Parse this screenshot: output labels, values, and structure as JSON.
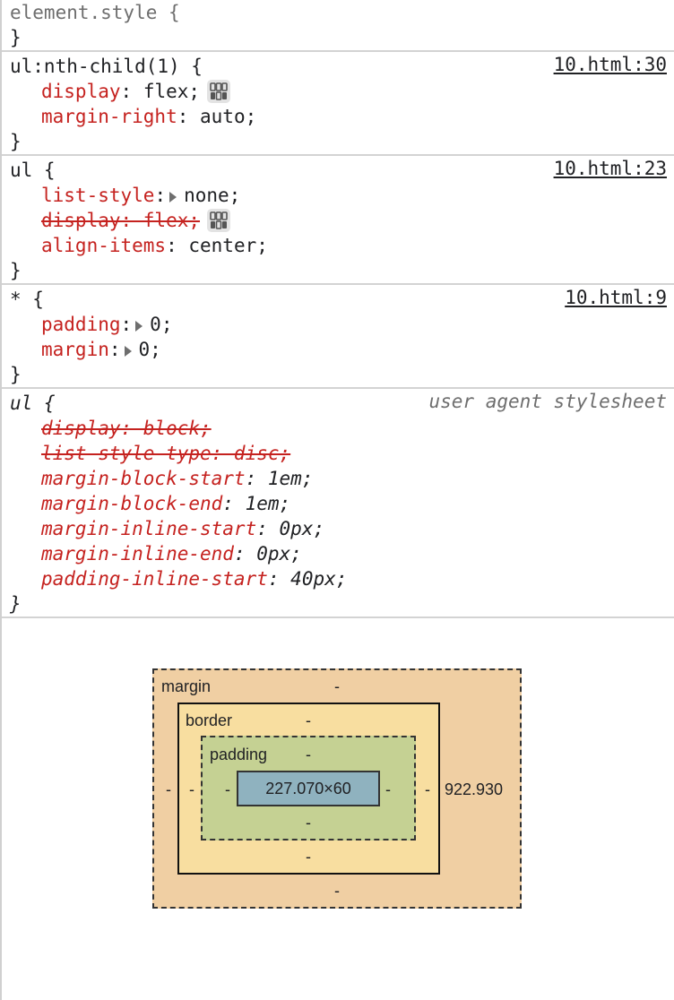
{
  "colors": {
    "property": "#c5221f",
    "margin_box": "#f0cfa3",
    "border_box": "#f8dea0",
    "padding_box": "#c5d193",
    "content_box": "#8fb2bf"
  },
  "element_style": {
    "selector": "element.style {",
    "close": "}"
  },
  "rules": [
    {
      "selector": "ul:nth-child(1) {",
      "source": "10.html:30",
      "decls": [
        {
          "prop": "display",
          "value": "flex;",
          "icon": "flexbox-editor-icon"
        },
        {
          "prop": "margin-right",
          "value": "auto;"
        }
      ],
      "close": "}"
    },
    {
      "selector": "ul {",
      "source": "10.html:23",
      "decls": [
        {
          "prop": "list-style",
          "value": "none;",
          "expandable": true
        },
        {
          "text": "display: flex;",
          "struck": true,
          "icon": "flexbox-editor-icon"
        },
        {
          "prop": "align-items",
          "value": "center;"
        }
      ],
      "close": "}"
    },
    {
      "selector": "* {",
      "source": "10.html:9",
      "decls": [
        {
          "prop": "padding",
          "value": "0;",
          "expandable": true
        },
        {
          "prop": "margin",
          "value": "0;",
          "expandable": true
        }
      ],
      "close": "}"
    }
  ],
  "ua_rule": {
    "selector": "ul {",
    "source_label": "user agent stylesheet",
    "decls": [
      {
        "text": "display: block;",
        "struck": true
      },
      {
        "text": "list-style-type: disc;",
        "struck": true
      },
      {
        "prop": "margin-block-start",
        "value": "1em;"
      },
      {
        "prop": "margin-block-end",
        "value": "1em;"
      },
      {
        "prop": "margin-inline-start",
        "value": "0px;"
      },
      {
        "prop": "margin-inline-end",
        "value": "0px;"
      },
      {
        "prop": "padding-inline-start",
        "value": "40px;"
      }
    ],
    "close": "}"
  },
  "box_model": {
    "margin_label": "margin",
    "border_label": "border",
    "padding_label": "padding",
    "content_size": "227.070×60",
    "margin_top": "-",
    "margin_bottom": "-",
    "margin_left": "-",
    "margin_right": "922.930",
    "border_top": "-",
    "border_bottom": "-",
    "border_left": "-",
    "border_right": "-",
    "padding_top": "-",
    "padding_bottom": "-",
    "padding_left": "-",
    "padding_right": "-"
  }
}
